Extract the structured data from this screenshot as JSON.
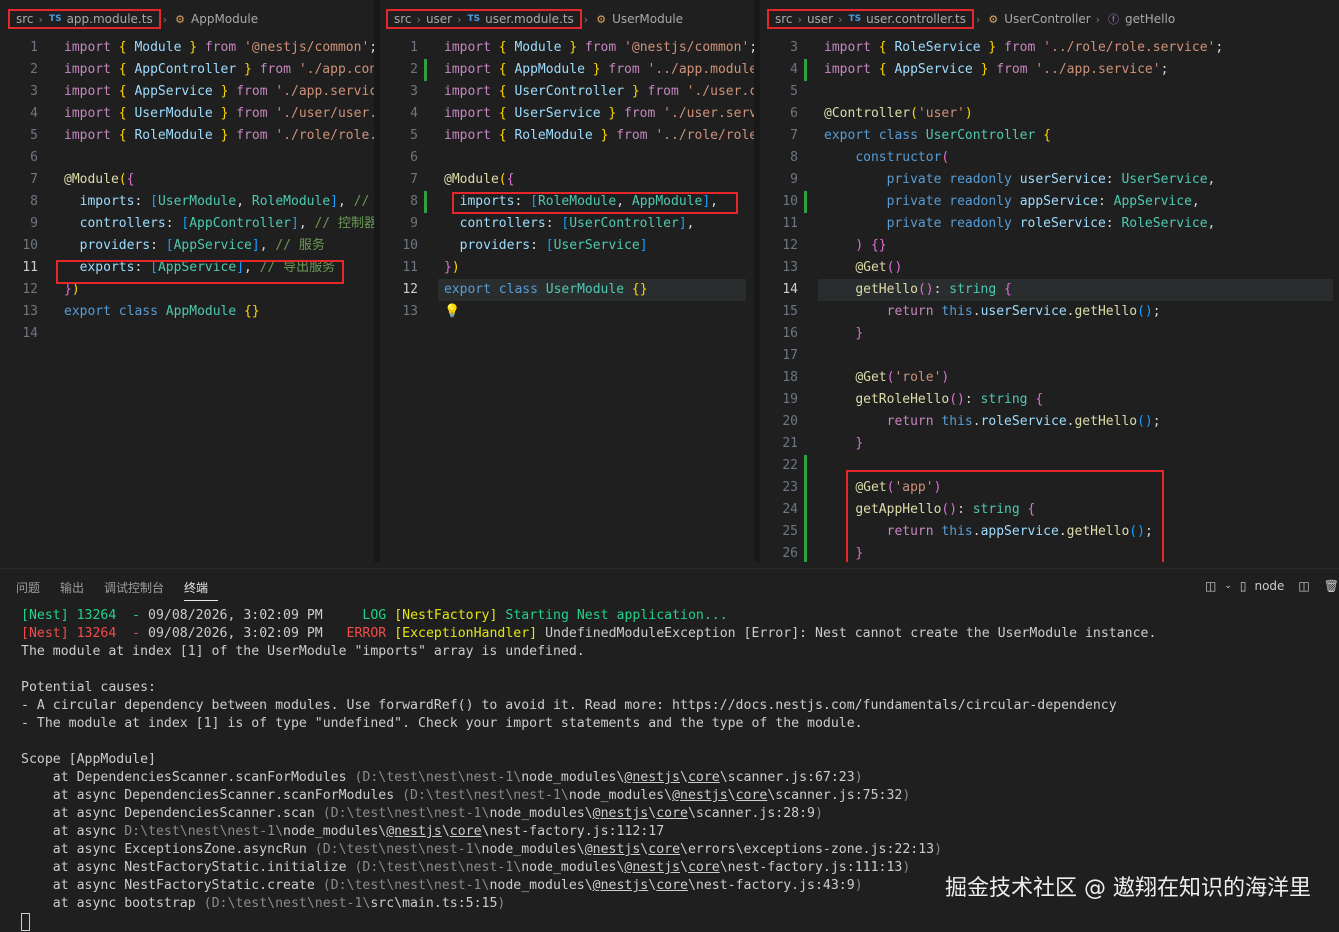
{
  "panes": [
    {
      "breadcrumb": {
        "folder": "src",
        "file": "app.module.ts",
        "symbol": "AppModule"
      },
      "lines": [
        {
          "n": "1",
          "h": "<span class='c'>import</span> <span class='b'>{</span> <span class='v'>Module</span> <span class='b'>}</span> <span class='c'>from</span> <span class='s'>'@nestjs/common'</span><span class='p'>;</span>"
        },
        {
          "n": "2",
          "h": "<span class='c'>import</span> <span class='b'>{</span> <span class='v'>AppController</span> <span class='b'>}</span> <span class='c'>from</span> <span class='s'>'./app.con</span>"
        },
        {
          "n": "3",
          "h": "<span class='c'>import</span> <span class='b'>{</span> <span class='v'>AppService</span> <span class='b'>}</span> <span class='c'>from</span> <span class='s'>'./app.servic</span>"
        },
        {
          "n": "4",
          "h": "<span class='c'>import</span> <span class='b'>{</span> <span class='v'>UserModule</span> <span class='b'>}</span> <span class='c'>from</span> <span class='s'>'./user/user.</span>"
        },
        {
          "n": "5",
          "h": "<span class='c'>import</span> <span class='b'>{</span> <span class='v'>RoleModule</span> <span class='b'>}</span> <span class='c'>from</span> <span class='s'>'./role/role.</span>"
        },
        {
          "n": "6",
          "h": ""
        },
        {
          "n": "7",
          "h": "<span class='f'>@Module</span><span class='b'>(</span><span class='br2'>{</span>"
        },
        {
          "n": "8",
          "h": "  <span class='v'>imports</span><span class='p'>:</span> <span class='br3'>[</span><span class='cl'>UserModule</span><span class='p'>,</span> <span class='cl'>RoleModule</span><span class='br3'>]</span><span class='p'>,</span> <span class='cm'>//</span>"
        },
        {
          "n": "9",
          "h": "  <span class='v'>controllers</span><span class='p'>:</span> <span class='br3'>[</span><span class='cl'>AppController</span><span class='br3'>]</span><span class='p'>,</span> <span class='cm'>// 控制器</span>"
        },
        {
          "n": "10",
          "h": "  <span class='v'>providers</span><span class='p'>:</span> <span class='br3'>[</span><span class='cl'>AppService</span><span class='br3'>]</span><span class='p'>,</span> <span class='cm'>// 服务</span>"
        },
        {
          "n": "11",
          "h": "  <span class='v'>exports</span><span class='p'>:</span> <span class='br3'>[</span><span class='cl'>AppService</span><span class='br3'>]</span><span class='p'>,</span> <span class='cm'>// 导出服务</span>"
        },
        {
          "n": "12",
          "h": "<span class='br2'>}</span><span class='b'>)</span>"
        },
        {
          "n": "13",
          "h": "<span class='k'>export</span> <span class='k'>class</span> <span class='cl'>AppModule</span> <span class='b'>{}</span>"
        },
        {
          "n": "14",
          "h": ""
        }
      ]
    },
    {
      "breadcrumb": {
        "folder": "src",
        "sub": "user",
        "file": "user.module.ts",
        "symbol": "UserModule"
      },
      "lines": [
        {
          "n": "1",
          "h": "<span class='c'>import</span> <span class='b'>{</span> <span class='v'>Module</span> <span class='b'>}</span> <span class='c'>from</span> <span class='s'>'@nestjs/common'</span><span class='p'>;</span>"
        },
        {
          "n": "2",
          "h": "<span class='c'>import</span> <span class='b'>{</span> <span class='v'>AppModule</span> <span class='b'>}</span> <span class='c'>from</span> <span class='s'>'../app.module</span>"
        },
        {
          "n": "3",
          "h": "<span class='c'>import</span> <span class='b'>{</span> <span class='v'>UserController</span> <span class='b'>}</span> <span class='c'>from</span> <span class='s'>'./user.c</span>"
        },
        {
          "n": "4",
          "h": "<span class='c'>import</span> <span class='b'>{</span> <span class='v'>UserService</span> <span class='b'>}</span> <span class='c'>from</span> <span class='s'>'./user.serv</span>"
        },
        {
          "n": "5",
          "h": "<span class='c'>import</span> <span class='b'>{</span> <span class='v'>RoleModule</span> <span class='b'>}</span> <span class='c'>from</span> <span class='s'>'../role/role</span>"
        },
        {
          "n": "6",
          "h": ""
        },
        {
          "n": "7",
          "h": "<span class='f'>@Module</span><span class='b'>(</span><span class='br2'>{</span>"
        },
        {
          "n": "8",
          "h": "  <span class='v'>imports</span><span class='p'>:</span> <span class='br3'>[</span><span class='cl'>RoleModule</span><span class='p'>,</span> <span class='cl'>AppModule</span><span class='br3'>]</span><span class='p'>,</span>"
        },
        {
          "n": "9",
          "h": "  <span class='v'>controllers</span><span class='p'>:</span> <span class='br3'>[</span><span class='cl'>UserController</span><span class='br3'>]</span><span class='p'>,</span>"
        },
        {
          "n": "10",
          "h": "  <span class='v'>providers</span><span class='p'>:</span> <span class='br3'>[</span><span class='cl'>UserService</span><span class='br3'>]</span>"
        },
        {
          "n": "11",
          "h": "<span class='br2'>}</span><span class='b'>)</span>"
        },
        {
          "n": "12",
          "h": "<span class='k'>export</span> <span class='k'>class</span> <span class='cl'>UserModule</span> <span class='b'>{}</span>"
        },
        {
          "n": "13",
          "h": "<span style='color:#ffcc00'>💡</span>"
        }
      ]
    },
    {
      "breadcrumb": {
        "folder": "src",
        "sub": "user",
        "file": "user.controller.ts",
        "symbol": "UserController",
        "method": "getHello"
      },
      "lines": [
        {
          "n": "3",
          "h": "<span class='c'>import</span> <span class='b'>{</span> <span class='v'>RoleService</span> <span class='b'>}</span> <span class='c'>from</span> <span class='s'>'../role/role.service'</span><span class='p'>;</span>"
        },
        {
          "n": "4",
          "h": "<span class='c'>import</span> <span class='b'>{</span> <span class='v'>AppService</span> <span class='b'>}</span> <span class='c'>from</span> <span class='s'>'../app.service'</span><span class='p'>;</span>"
        },
        {
          "n": "5",
          "h": ""
        },
        {
          "n": "6",
          "h": "<span class='f'>@Controller</span><span class='b'>(</span><span class='s'>'user'</span><span class='b'>)</span>"
        },
        {
          "n": "7",
          "h": "<span class='k'>export</span> <span class='k'>class</span> <span class='cl'>UserController</span> <span class='b'>{</span>"
        },
        {
          "n": "8",
          "h": "    <span class='k'>constructor</span><span class='br2'>(</span>"
        },
        {
          "n": "9",
          "h": "        <span class='k'>private</span> <span class='k'>readonly</span> <span class='v'>userService</span><span class='p'>:</span> <span class='cl'>UserService</span><span class='p'>,</span>"
        },
        {
          "n": "10",
          "h": "        <span class='k'>private</span> <span class='k'>readonly</span> <span class='v'>appService</span><span class='p'>:</span> <span class='cl'>AppService</span><span class='p'>,</span>"
        },
        {
          "n": "11",
          "h": "        <span class='k'>private</span> <span class='k'>readonly</span> <span class='v'>roleService</span><span class='p'>:</span> <span class='cl'>RoleService</span><span class='p'>,</span>"
        },
        {
          "n": "12",
          "h": "    <span class='br2'>)</span> <span class='br2'>{}</span>"
        },
        {
          "n": "13",
          "h": "    <span class='f'>@Get</span><span class='br2'>()</span>"
        },
        {
          "n": "14",
          "h": "    <span class='f'>getHello</span><span class='br2'>()</span><span class='p'>:</span> <span class='cl'>string</span> <span class='br2'>{</span>"
        },
        {
          "n": "15",
          "h": "        <span class='c'>return</span> <span class='k'>this</span><span class='p'>.</span><span class='v'>userService</span><span class='p'>.</span><span class='f'>getHello</span><span class='br3'>()</span><span class='p'>;</span>"
        },
        {
          "n": "16",
          "h": "    <span class='br2'>}</span>"
        },
        {
          "n": "17",
          "h": ""
        },
        {
          "n": "18",
          "h": "    <span class='f'>@Get</span><span class='br2'>(</span><span class='s'>'role'</span><span class='br2'>)</span>"
        },
        {
          "n": "19",
          "h": "    <span class='f'>getRoleHello</span><span class='br2'>()</span><span class='p'>:</span> <span class='cl'>string</span> <span class='br2'>{</span>"
        },
        {
          "n": "20",
          "h": "        <span class='c'>return</span> <span class='k'>this</span><span class='p'>.</span><span class='v'>roleService</span><span class='p'>.</span><span class='f'>getHello</span><span class='br3'>()</span><span class='p'>;</span>"
        },
        {
          "n": "21",
          "h": "    <span class='br2'>}</span>"
        },
        {
          "n": "22",
          "h": ""
        },
        {
          "n": "23",
          "h": "    <span class='f'>@Get</span><span class='br2'>(</span><span class='s'>'app'</span><span class='br2'>)</span>"
        },
        {
          "n": "24",
          "h": "    <span class='f'>getAppHello</span><span class='br2'>()</span><span class='p'>:</span> <span class='cl'>string</span> <span class='br2'>{</span>"
        },
        {
          "n": "25",
          "h": "        <span class='c'>return</span> <span class='k'>this</span><span class='p'>.</span><span class='v'>appService</span><span class='p'>.</span><span class='f'>getHello</span><span class='br3'>()</span><span class='p'>;</span>"
        },
        {
          "n": "26",
          "h": "    <span class='br2'>}</span>"
        }
      ]
    }
  ],
  "panel": {
    "tabs": [
      "问题",
      "输出",
      "调试控制台",
      "终端"
    ],
    "active_tab": "终端",
    "terminal_label": "node"
  },
  "terminal": {
    "lines": [
      "<span class='t-green'>[Nest] 13264  - </span>09/08/2026, 3:02:09 PM <span class='t-green'>    LOG </span><span class='t-yellow'>[NestFactory]</span> <span class='t-green'>Starting Nest application...</span>",
      "<span class='t-red'>[Nest] 13264  - </span>09/08/2026, 3:02:09 PM <span class='t-red'>  ERROR </span><span class='t-yellow'>[ExceptionHandler]</span> UndefinedModuleException [Error]: Nest cannot create the UserModule instance.",
      "The module at index [1] of the UserModule \"imports\" array is undefined.",
      "",
      "Potential causes:",
      "- A circular dependency between modules. Use forwardRef() to avoid it. Read more: https://docs.nestjs.com/fundamentals/circular-dependency",
      "- The module at index [1] is of type \"undefined\". Check your import statements and the type of the module.",
      "",
      "Scope [AppModule]",
      "    at DependenciesScanner.scanForModules <span class='t-dim'>(D:\\test\\nest\\nest-1\\</span>node_modules\\<span class='u'>@nestjs</span>\\<span class='u'>core</span>\\scanner.js:67:23<span class='t-dim'>)</span>",
      "    at async DependenciesScanner.scanForModules <span class='t-dim'>(D:\\test\\nest\\nest-1\\</span>node_modules\\<span class='u'>@nestjs</span>\\<span class='u'>core</span>\\scanner.js:75:32<span class='t-dim'>)</span>",
      "    at async DependenciesScanner.scan <span class='t-dim'>(D:\\test\\nest\\nest-1\\</span>node_modules\\<span class='u'>@nestjs</span>\\<span class='u'>core</span>\\scanner.js:28:9<span class='t-dim'>)</span>",
      "    at async <span class='t-dim'>D:\\test\\nest\\nest-1\\</span>node_modules\\<span class='u'>@nestjs</span>\\<span class='u'>core</span>\\nest-factory.js:112:17",
      "    at async ExceptionsZone.asyncRun <span class='t-dim'>(D:\\test\\nest\\nest-1\\</span>node_modules\\<span class='u'>@nestjs</span>\\<span class='u'>core</span>\\errors\\exceptions-zone.js:22:13<span class='t-dim'>)</span>",
      "    at async NestFactoryStatic.initialize <span class='t-dim'>(D:\\test\\nest\\nest-1\\</span>node_modules\\<span class='u'>@nestjs</span>\\<span class='u'>core</span>\\nest-factory.js:111:13<span class='t-dim'>)</span>",
      "    at async NestFactoryStatic.create <span class='t-dim'>(D:\\test\\nest\\nest-1\\</span>node_modules\\<span class='u'>@nestjs</span>\\<span class='u'>core</span>\\nest-factory.js:43:9<span class='t-dim'>)</span>",
      "    at async bootstrap <span class='t-dim'>(D:\\test\\nest\\nest-1\\</span>src\\main.ts:5:15<span class='t-dim'>)</span>"
    ]
  },
  "watermark": "掘金技术社区 @ 遨翔在知识的海洋里"
}
